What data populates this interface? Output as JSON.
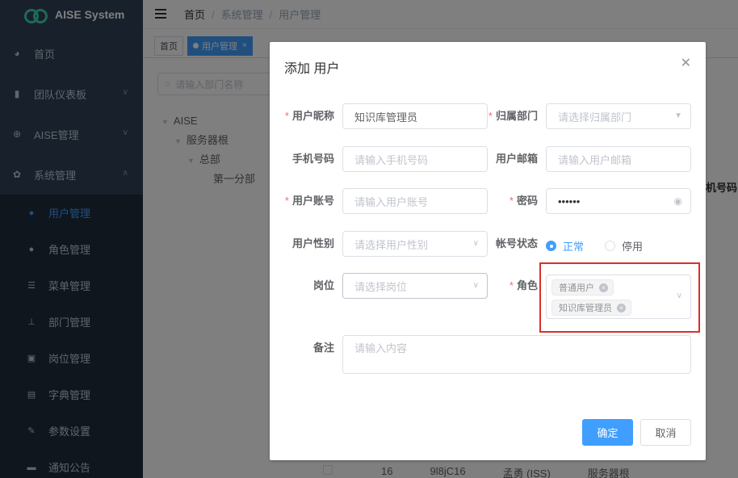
{
  "app": {
    "name": "AISE System"
  },
  "sidebar": {
    "items": [
      {
        "label": "首页",
        "icon": "dashboard-icon"
      },
      {
        "label": "团队仪表板",
        "icon": "bar-chart-icon"
      },
      {
        "label": "AISE管理",
        "icon": "puzzle-icon"
      },
      {
        "label": "系统管理",
        "icon": "gear-icon"
      }
    ],
    "subitems": [
      {
        "label": "用户管理",
        "icon": "user-icon",
        "active": true
      },
      {
        "label": "角色管理",
        "icon": "users-icon"
      },
      {
        "label": "菜单管理",
        "icon": "tree-table-icon"
      },
      {
        "label": "部门管理",
        "icon": "org-chart-icon"
      },
      {
        "label": "岗位管理",
        "icon": "post-icon"
      },
      {
        "label": "字典管理",
        "icon": "dictionary-icon"
      },
      {
        "label": "参数设置",
        "icon": "edit-icon"
      },
      {
        "label": "通知公告",
        "icon": "message-icon"
      }
    ]
  },
  "breadcrumb": {
    "home": "首页",
    "section": "系统管理",
    "current": "用户管理"
  },
  "tags": {
    "home": "首页",
    "active": "用户管理"
  },
  "background": {
    "dept_search_placeholder": "请输入部门名称",
    "tree": {
      "root": "AISE",
      "level1": "服务器根",
      "level2": "总部",
      "level3": "第一分部"
    },
    "col_header": "机号码",
    "row": {
      "id": "16",
      "code": "9l8jC16",
      "name": "孟勇 (ISS)",
      "dept": "服务器根"
    }
  },
  "dialog": {
    "title": "添加 用户",
    "fields": {
      "nickname": {
        "label": "用户昵称",
        "value": "知识库管理员"
      },
      "dept": {
        "label": "归属部门",
        "placeholder": "请选择归属部门"
      },
      "phone": {
        "label": "手机号码",
        "placeholder": "请输入手机号码"
      },
      "email": {
        "label": "用户邮箱",
        "placeholder": "请输入用户邮箱"
      },
      "account": {
        "label": "用户账号",
        "placeholder": "请输入用户账号"
      },
      "password": {
        "label": "密码",
        "value": "••••••"
      },
      "gender": {
        "label": "用户性别",
        "placeholder": "请选择用户性别"
      },
      "status": {
        "label": "帐号状态",
        "options": [
          "正常",
          "停用"
        ],
        "selected": "正常"
      },
      "post": {
        "label": "岗位",
        "placeholder": "请选择岗位"
      },
      "role": {
        "label": "角色",
        "selected": [
          "普通用户",
          "知识库管理员"
        ]
      },
      "remark": {
        "label": "备注",
        "placeholder": "请输入内容"
      }
    },
    "buttons": {
      "confirm": "确定",
      "cancel": "取消"
    }
  },
  "colors": {
    "accent": "#409eff",
    "sidebar": "#304156",
    "highlight": "#d9302b"
  }
}
